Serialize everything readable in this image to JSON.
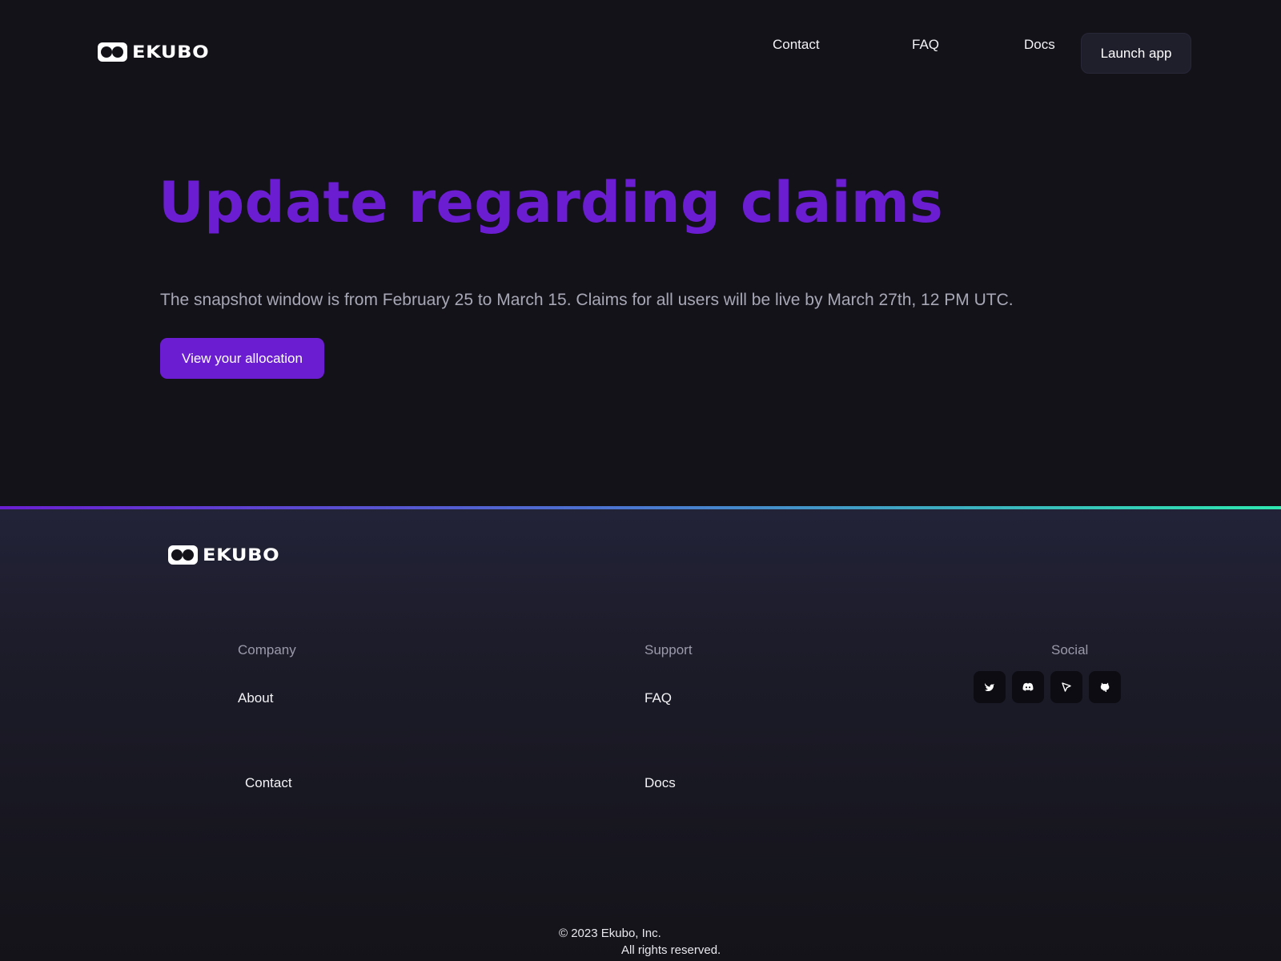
{
  "brand": {
    "name": "EKUBO"
  },
  "header": {
    "nav": {
      "contact": "Contact",
      "faq": "FAQ",
      "docs": "Docs"
    },
    "launch_label": "Launch app"
  },
  "hero": {
    "title": "Update regarding claims",
    "subtitle": "The snapshot window is from February 25 to March 15. Claims for all users will be live by March 27th, 12 PM UTC.",
    "cta_label": "View your allocation"
  },
  "footer": {
    "company": {
      "heading": "Company",
      "about": "About",
      "contact": "Contact"
    },
    "support": {
      "heading": "Support",
      "faq": "FAQ",
      "docs": "Docs"
    },
    "social": {
      "heading": "Social",
      "icons": [
        "twitter-icon",
        "discord-icon",
        "cursor-icon",
        "github-icon"
      ]
    },
    "copyright": "© 2023 Ekubo, Inc.",
    "rights": "All rights reserved."
  },
  "colors": {
    "background": "#131219",
    "accent": "#6b1dd1",
    "button_dark": "#1f1f2c",
    "gradient_start": "#6a1fd1",
    "gradient_end": "#2ee8b0"
  }
}
